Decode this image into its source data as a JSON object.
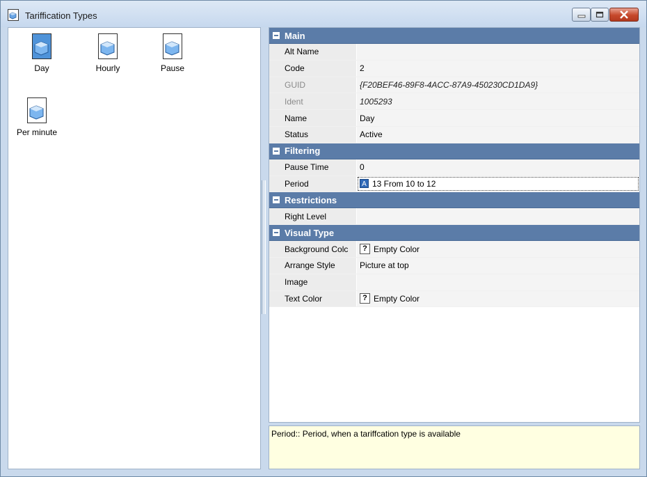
{
  "window": {
    "title": "Tariffication Types"
  },
  "tiles": [
    {
      "label": "Day"
    },
    {
      "label": "Hourly"
    },
    {
      "label": "Pause"
    },
    {
      "label": "Per minute"
    }
  ],
  "grid": {
    "categories": [
      {
        "name": "Main",
        "rows": [
          {
            "name": "Alt Name",
            "value": ""
          },
          {
            "name": "Code",
            "value": "2"
          },
          {
            "name": "GUID",
            "value": "{F20BEF46-89F8-4ACC-87A9-450230CD1DA9}",
            "readonly": true
          },
          {
            "name": "Ident",
            "value": "1005293",
            "readonly": true
          },
          {
            "name": "Name",
            "value": "Day"
          },
          {
            "name": "Status",
            "value": "Active"
          }
        ]
      },
      {
        "name": "Filtering",
        "rows": [
          {
            "name": "Pause Time",
            "value": "0"
          },
          {
            "name": "Period",
            "value": "13 From 10 to 12",
            "selected": true
          }
        ]
      },
      {
        "name": "Restrictions",
        "rows": [
          {
            "name": "Right Level",
            "value": ""
          }
        ]
      },
      {
        "name": "Visual Type",
        "rows": [
          {
            "name": "Background Colc",
            "value": "Empty Color",
            "badge": "?"
          },
          {
            "name": "Arrange Style",
            "value": "Picture at top"
          },
          {
            "name": "Image",
            "value": ""
          },
          {
            "name": "Text Color",
            "value": "Empty Color",
            "badge": "?"
          }
        ]
      }
    ]
  },
  "description": {
    "text": "Period:: Period, when a tariffcation type is available"
  },
  "colors": {
    "category_bar": "#5b7ca8",
    "desc_bg": "#ffffe1",
    "titlebar": "#c6d8ee"
  }
}
